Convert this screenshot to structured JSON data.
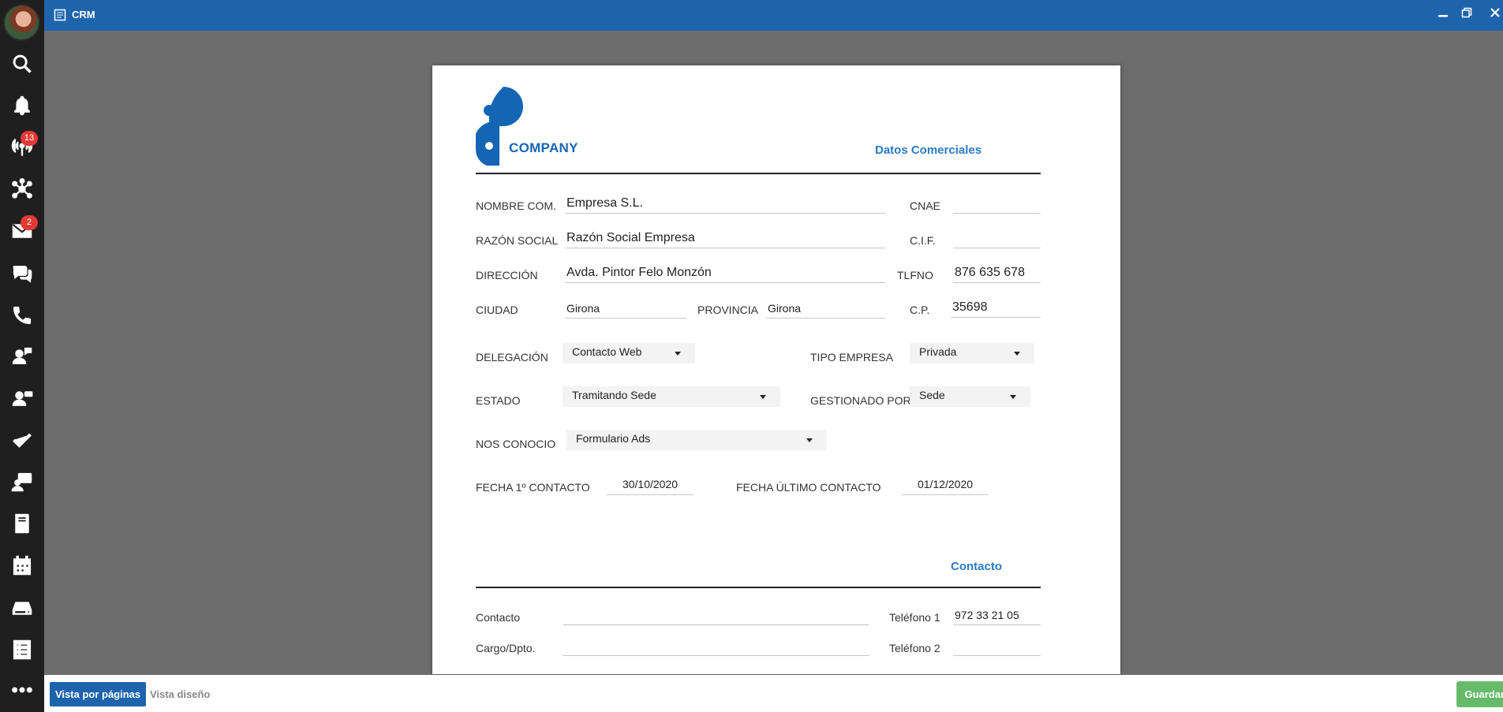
{
  "window": {
    "title": "CRM"
  },
  "sidebar": {
    "items": [
      {
        "name": "search-icon"
      },
      {
        "name": "bell-icon"
      },
      {
        "name": "antenna-icon",
        "badge": "13"
      },
      {
        "name": "network-icon"
      },
      {
        "name": "mail-icon",
        "badge": "2"
      },
      {
        "name": "chat-icon"
      },
      {
        "name": "phone-icon"
      },
      {
        "name": "agent-chat-icon"
      },
      {
        "name": "agent-ticket-icon"
      },
      {
        "name": "check-icon"
      },
      {
        "name": "monitor-user-icon"
      },
      {
        "name": "book-icon"
      },
      {
        "name": "calendar-icon"
      },
      {
        "name": "storage-icon"
      },
      {
        "name": "list-icon"
      },
      {
        "name": "more-icon"
      }
    ]
  },
  "document": {
    "logo_text": "COMPANY",
    "section_commercial": "Datos Comerciales",
    "nombre_label": "NOMBRE COM.",
    "nombre_value": "Empresa S.L.",
    "cnae_label": "CNAE",
    "cnae_value": "",
    "razon_label": "RAZÓN SOCIAL",
    "razon_value": "Razón Social Empresa",
    "cif_label": "C.I.F.",
    "cif_value": "",
    "direccion_label": "DIRECCIÓN",
    "direccion_value": "Avda. Pintor Felo Monzón",
    "tlfno_label": "TLFNO",
    "tlfno_value": "876 635 678",
    "ciudad_label": "CIUDAD",
    "ciudad_value": "Girona",
    "provincia_label": "PROVINCIA",
    "provincia_value": "Girona",
    "cp_label": "C.P.",
    "cp_value": "35698",
    "delegacion_label": "DELEGACIÓN",
    "delegacion_value": "Contacto Web",
    "tipo_label": "TIPO EMPRESA",
    "tipo_value": "Privada",
    "estado_label": "ESTADO",
    "estado_value": "Tramitando Sede",
    "gestionado_label": "GESTIONADO POR",
    "gestionado_value": "Sede",
    "nos_conocio_label": "NOS CONOCIO",
    "nos_conocio_value": "Formulario Ads",
    "fecha1_label": "FECHA 1º CONTACTO",
    "fecha1_value": "30/10/2020",
    "fecha_ultimo_label": "FECHA ÚLTIMO CONTACTO",
    "fecha_ultimo_value": "01/12/2020",
    "section_contact": "Contacto",
    "contacto_label": "Contacto",
    "contacto_value": "",
    "telefono1_label": "Teléfono 1",
    "telefono1_value": "972 33 21 05",
    "cargo_label": "Cargo/Dpto.",
    "cargo_value": "",
    "telefono2_label": "Teléfono 2",
    "telefono2_value": ""
  },
  "bottombar": {
    "pages_label": "Vista por páginas",
    "design_label": "Vista diseño",
    "save_label": "Guardar"
  },
  "colors": {
    "accent": "#1e64ad",
    "save": "#66bb6a",
    "badge": "#e53935"
  }
}
